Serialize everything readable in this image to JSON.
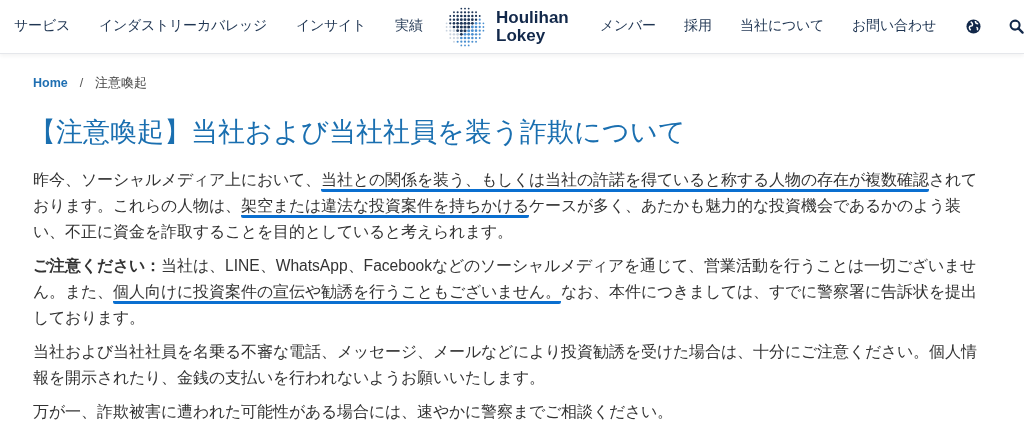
{
  "nav_left": [
    "サービス",
    "インダストリーカバレッジ",
    "インサイト",
    "実績"
  ],
  "logo": {
    "line1": "Houlihan",
    "line2": "Lokey"
  },
  "nav_right": [
    "メンバー",
    "採用",
    "当社について",
    "お問い合わせ"
  ],
  "breadcrumb": [
    {
      "label": "Home",
      "link": true
    },
    {
      "label": "注意喚起",
      "link": false
    }
  ],
  "breadcrumb_separator": "/",
  "title": "【注意喚起】当社および当社社員を装う詐欺について",
  "paragraphs": [
    [
      {
        "text": "昨今、ソーシャルメディア上において、",
        "underlined": false
      },
      {
        "text": "当社との関係を装う、もしくは当社の許諾を得ていると称する人物の存在が複数確認",
        "underlined": true
      },
      {
        "text": "されております。これらの人物は、",
        "underlined": false
      },
      {
        "text": "架空または違法な投資案件を持ちかける",
        "underlined": true
      },
      {
        "text": "ケースが多く、あたかも魅力的な投資機会であるかのよう装い、不正に資金を詐取することを目的としていると考えられます。",
        "underlined": false
      }
    ],
    [
      {
        "text": "**ご注意ください：**当社は、LINE、WhatsApp、Facebookなどのソーシャルメディアを通じて、営業活動を行うことは一切ございません。また、",
        "underlined": false
      },
      {
        "text": "個人向けに投資案件の宣伝や勧誘を行うこともございません。",
        "underlined": true
      },
      {
        "text": "なお、本件につきましては、すでに警察署に告訴状を提出しております。",
        "underlined": false
      }
    ],
    [
      {
        "text": "当社および当社社員を名乗る不審な電話、メッセージ、メールなどにより投資勧誘を受けた場合は、十分にご注意ください。個人情報を開示されたり、金銭の支払いを行われないようお願いいたします。",
        "underlined": false
      }
    ],
    [
      {
        "text": "万が一、詐欺被害に遭われた可能性がある場合には、速やかに警察までご相談ください。",
        "underlined": false
      }
    ]
  ]
}
